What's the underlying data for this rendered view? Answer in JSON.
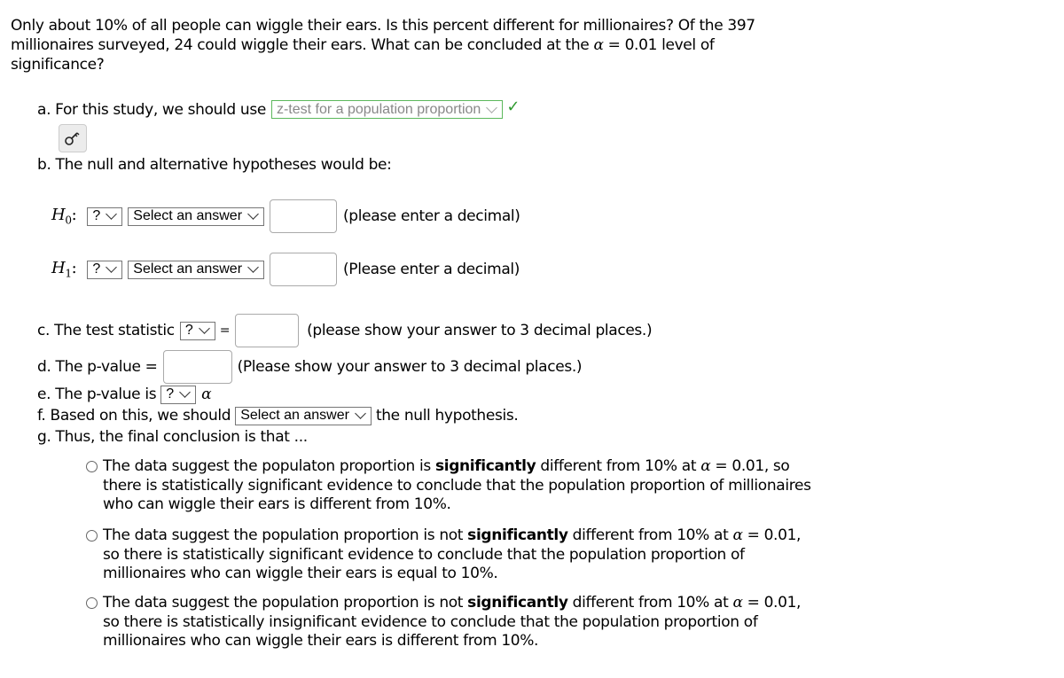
{
  "question": {
    "part1": "Only about 10% of all people can wiggle their ears. Is this percent different for millionaires? Of the 397 millionaires surveyed, 24 could wiggle their ears. What can be concluded at the ",
    "alpha": "α",
    "part2": " = 0.01 level of significance?"
  },
  "part_a": {
    "label": "a. For this study, we should use",
    "selected": "z-test for a population proportion",
    "status": "correct",
    "check_glyph": "✓",
    "accent_color": "#5cb85c"
  },
  "help_button": {
    "icon": "key-icon"
  },
  "part_b": {
    "label": "b. The null and alternative hypotheses would be:",
    "h0": {
      "symbol": "H",
      "subscript": "0",
      "colon": ":",
      "param_select": "?",
      "relation_select": "Select an answer",
      "value": "",
      "hint": "(please enter a decimal)"
    },
    "h1": {
      "symbol": "H",
      "subscript": "1",
      "colon": ":",
      "param_select": "?",
      "relation_select": "Select an answer",
      "value": "",
      "hint": "(Please enter a decimal)"
    }
  },
  "part_c": {
    "label": "c. The test statistic",
    "select": "?",
    "equals": "=",
    "value": "",
    "hint": "(please show your answer to 3 decimal places.)"
  },
  "part_d": {
    "label": "d. The p-value =",
    "value": "",
    "hint": "(Please show your answer to 3 decimal places.)"
  },
  "part_e": {
    "label": "e. The p-value is",
    "select": "?",
    "alpha": "α"
  },
  "part_f": {
    "label": "f. Based on this, we should",
    "select": "Select an answer",
    "suffix": "the null hypothesis."
  },
  "part_g": {
    "label": "g. Thus, the final conclusion is that ...",
    "options": [
      {
        "pre": "The data suggest the populaton proportion is ",
        "bold": "significantly",
        "mid": " different from 10% at ",
        "alpha": "α",
        "post": " = 0.01, so there is statistically significant evidence to conclude that the population proportion of millionaires who can wiggle their ears is different from 10%."
      },
      {
        "pre": "The data suggest the population proportion is not ",
        "bold": "significantly",
        "mid": " different from 10% at ",
        "alpha": "α",
        "post": " = 0.01, so there is statistically significant evidence to conclude that the population proportion of millionaires who can wiggle their ears is equal to 10%."
      },
      {
        "pre": "The data suggest the population proportion is not ",
        "bold": "significantly",
        "mid": " different from 10% at ",
        "alpha": "α",
        "post": " = 0.01, so there is statistically insignificant evidence to conclude that the population proportion of millionaires who can wiggle their ears is different from 10%."
      }
    ]
  }
}
